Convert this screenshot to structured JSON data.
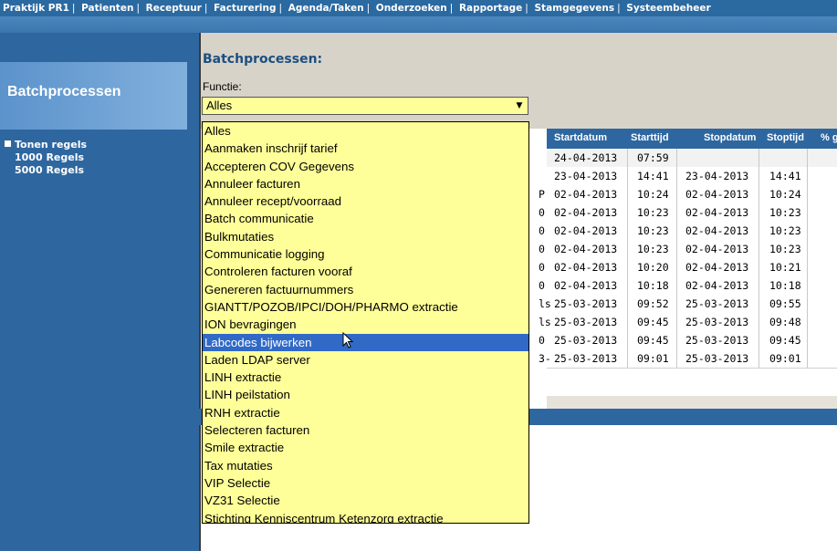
{
  "topmenu": {
    "items": [
      "Praktijk PR1",
      "Patienten",
      "Receptuur",
      "Facturering",
      "Agenda/Taken",
      "Onderzoeken",
      "Rapportage",
      "Stamgegevens",
      "Systeembeheer"
    ]
  },
  "sidebar": {
    "title": "Batchprocessen",
    "group": "Tonen regels",
    "items": [
      "1000 Regels",
      "5000 Regels"
    ]
  },
  "main": {
    "title": "Batchprocessen:",
    "function_label": "Functie:",
    "function_value": "Alles"
  },
  "table": {
    "headers": [
      "Startdatum",
      "Starttijd",
      "Stopdatum",
      "Stoptijd",
      "% g"
    ],
    "rows": [
      {
        "prefix": "",
        "start_date": "24-04-2013",
        "start_time": "07:59",
        "stop_date": "",
        "stop_time": ""
      },
      {
        "prefix": "",
        "start_date": "23-04-2013",
        "start_time": "14:41",
        "stop_date": "23-04-2013",
        "stop_time": "14:41"
      },
      {
        "prefix": "P",
        "start_date": "02-04-2013",
        "start_time": "10:24",
        "stop_date": "02-04-2013",
        "stop_time": "10:24"
      },
      {
        "prefix": "0",
        "start_date": "02-04-2013",
        "start_time": "10:23",
        "stop_date": "02-04-2013",
        "stop_time": "10:23"
      },
      {
        "prefix": "0",
        "start_date": "02-04-2013",
        "start_time": "10:23",
        "stop_date": "02-04-2013",
        "stop_time": "10:23"
      },
      {
        "prefix": "0",
        "start_date": "02-04-2013",
        "start_time": "10:23",
        "stop_date": "02-04-2013",
        "stop_time": "10:23"
      },
      {
        "prefix": "0",
        "start_date": "02-04-2013",
        "start_time": "10:20",
        "stop_date": "02-04-2013",
        "stop_time": "10:21"
      },
      {
        "prefix": "0",
        "start_date": "02-04-2013",
        "start_time": "10:18",
        "stop_date": "02-04-2013",
        "stop_time": "10:18"
      },
      {
        "prefix": "ls",
        "start_date": "25-03-2013",
        "start_time": "09:52",
        "stop_date": "25-03-2013",
        "stop_time": "09:55"
      },
      {
        "prefix": "ls",
        "start_date": "25-03-2013",
        "start_time": "09:45",
        "stop_date": "25-03-2013",
        "stop_time": "09:48"
      },
      {
        "prefix": "0",
        "start_date": "25-03-2013",
        "start_time": "09:45",
        "stop_date": "25-03-2013",
        "stop_time": "09:45"
      },
      {
        "prefix": "3-",
        "start_date": "25-03-2013",
        "start_time": "09:01",
        "stop_date": "25-03-2013",
        "stop_time": "09:01"
      }
    ]
  },
  "dropdown": {
    "selected": "Labcodes bijwerken",
    "options": [
      "Alles",
      "Aanmaken inschrijf tarief",
      "Accepteren COV Gegevens",
      "Annuleer facturen",
      "Annuleer recept/voorraad",
      "Batch communicatie",
      "Bulkmutaties",
      "Communicatie logging",
      "Controleren facturen vooraf",
      "Genereren factuurnummers",
      "GIANTT/POZOB/IPCI/DOH/PHARMO extractie",
      "ION bevragingen",
      "Labcodes bijwerken",
      "Laden LDAP server",
      "LINH extractie",
      "LINH peilstation",
      "RNH extractie",
      "Selecteren facturen",
      "Smile extractie",
      "Tax mutaties",
      "VIP Selectie",
      "VZ31 Selectie",
      "Stichting Kenniscentrum Ketenzorg extractie"
    ]
  },
  "colors": {
    "menu_blue": "#2b69a1",
    "dropdown_yellow": "#ffff99",
    "selection_blue": "#3169c6"
  }
}
